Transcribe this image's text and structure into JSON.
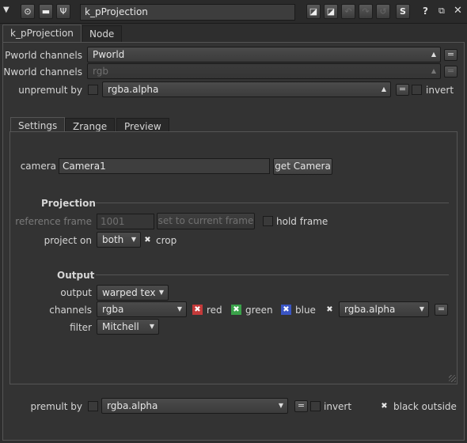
{
  "toolbar": {
    "node_name": "k_pProjection",
    "icons": [
      "collapse-arrow",
      "target-icon",
      "pan-icon",
      "wrench-icon",
      "color-swatch-icon",
      "color-swatch-alt-icon",
      "undo-icon",
      "redo-icon",
      "revert-icon",
      "script-icon",
      "help-icon",
      "float-icon",
      "close-icon"
    ],
    "s_label": "S",
    "help_label": "?"
  },
  "tabs": [
    "k_pProjection",
    "Node"
  ],
  "top": {
    "pworld_label": "Pworld channels",
    "pworld_value": "Pworld",
    "nworld_label": "Nworld channels",
    "nworld_value": "rgb",
    "unpremult_label": "unpremult by",
    "unpremult_value": "rgba.alpha",
    "invert_label": "invert",
    "eq": "="
  },
  "subtabs": [
    "Settings",
    "Zrange",
    "Preview"
  ],
  "settings": {
    "camera_label": "camera",
    "camera_value": "Camera1",
    "get_camera": "get Camera",
    "projection_header": "Projection",
    "ref_frame_label": "reference frame",
    "ref_frame_value": "1001",
    "set_current": "set to current frame",
    "hold_frame": "hold frame",
    "project_on_label": "project on",
    "project_on_value": "both",
    "crop_label": "crop",
    "output_header": "Output",
    "output_label": "output",
    "output_value": "warped tex",
    "channels_label": "channels",
    "channels_value": "rgba",
    "red": "red",
    "green": "green",
    "blue": "blue",
    "alpha_value": "rgba.alpha",
    "filter_label": "filter",
    "filter_value": "Mitchell"
  },
  "bottom": {
    "premult_label": "premult by",
    "premult_value": "rgba.alpha",
    "invert_label": "invert",
    "black_outside": "black outside"
  },
  "colors": {
    "red": "#c43a3a",
    "green": "#3aa24a",
    "blue": "#3a55c4"
  }
}
